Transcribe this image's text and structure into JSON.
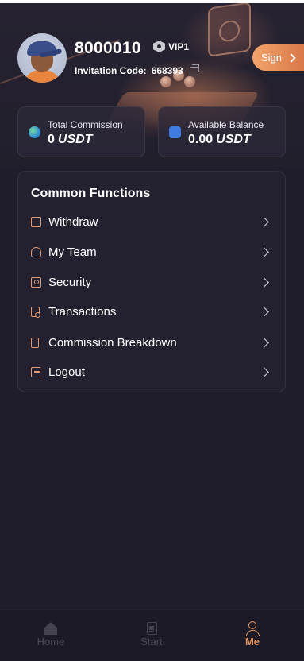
{
  "profile": {
    "username": "8000010",
    "vip": "VIP1",
    "invitation_label": "Invitation Code:",
    "invitation_code": "668393"
  },
  "sign_button": {
    "label": "Sign"
  },
  "stats": {
    "total_commission": {
      "label": "Total Commission",
      "value": "0",
      "unit": "USDT"
    },
    "available_balance": {
      "label": "Available Balance",
      "value": "0.00",
      "unit": "USDT"
    }
  },
  "functions": {
    "title": "Common Functions",
    "items": [
      {
        "label": "Withdraw",
        "icon": "wallet-icon"
      },
      {
        "label": "My Team",
        "icon": "team-icon"
      },
      {
        "label": "Security",
        "icon": "security-icon"
      },
      {
        "label": "Transactions",
        "icon": "transactions-icon"
      },
      {
        "label": "Commission Breakdown",
        "icon": "commission-icon"
      },
      {
        "label": "Logout",
        "icon": "logout-icon"
      }
    ]
  },
  "tabbar": {
    "tabs": [
      {
        "label": "Home",
        "icon": "home-icon",
        "active": false
      },
      {
        "label": "Start",
        "icon": "clipboard-icon",
        "active": false
      },
      {
        "label": "Me",
        "icon": "user-icon",
        "active": true
      }
    ]
  },
  "colors": {
    "background": "#1f1d2b",
    "accent": "#e7955e",
    "sign_gradient_start": "#f2a46a",
    "sign_gradient_end": "#d9784a"
  }
}
